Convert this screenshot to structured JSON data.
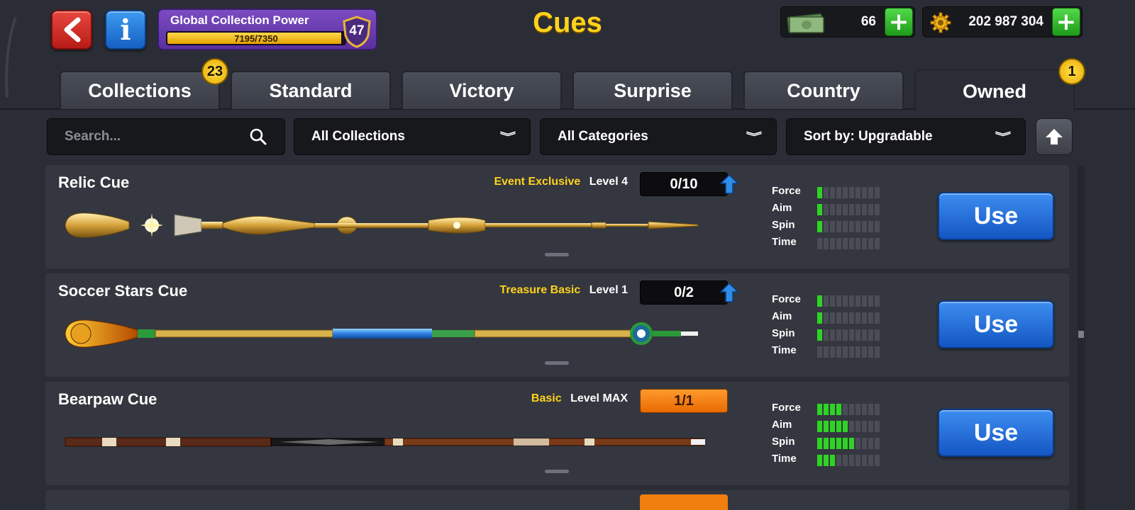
{
  "header": {
    "title": "Cues",
    "global_collection_power": {
      "label": "Global Collection Power",
      "current": 7195,
      "max": 7350,
      "progress_text": "7195/7350",
      "level": "47"
    },
    "cash": "66",
    "coins": "202 987 304",
    "plus_symbol": "+"
  },
  "tabs": [
    {
      "label": "Collections",
      "badge": "23",
      "active": false
    },
    {
      "label": "Standard",
      "active": false
    },
    {
      "label": "Victory",
      "active": false
    },
    {
      "label": "Surprise",
      "active": false
    },
    {
      "label": "Country",
      "active": false
    },
    {
      "label": "Owned",
      "badge": "1",
      "active": true
    }
  ],
  "filters": {
    "search_placeholder": "Search...",
    "collections": "All Collections",
    "categories": "All Categories",
    "sort": "Sort by: Upgradable"
  },
  "stat_labels": [
    "Force",
    "Aim",
    "Spin",
    "Time"
  ],
  "use_label": "Use",
  "cues": [
    {
      "name": "Relic Cue",
      "category": "Event Exclusive",
      "level": "Level 4",
      "progress": "0/10",
      "upgradable": true,
      "stats": {
        "force": 1,
        "aim": 1,
        "spin": 1,
        "time": 0
      }
    },
    {
      "name": "Soccer Stars Cue",
      "category": "Treasure Basic",
      "level": "Level 1",
      "progress": "0/2",
      "upgradable": true,
      "stats": {
        "force": 1,
        "aim": 1,
        "spin": 1,
        "time": 0
      }
    },
    {
      "name": "Bearpaw Cue",
      "category": "Basic",
      "level": "Level MAX",
      "progress": "1/1",
      "upgradable": false,
      "stats": {
        "force": 4,
        "aim": 5,
        "spin": 6,
        "time": 3
      }
    }
  ],
  "colors": {
    "background": "#2a2d35",
    "card": "#34373f",
    "accent_yellow": "#ffd21c",
    "stat_on": "#2fd326",
    "use_blue": "#1f6ad8",
    "max_orange": "#f07f10"
  },
  "icons": {
    "back": "chevron-left-icon",
    "info": "info-icon",
    "level": "shield-icon",
    "cash": "cash-icon",
    "coins": "gear-coin-icon",
    "search": "search-icon",
    "sort_direction": "arrow-up-icon",
    "upgrade": "upgrade-arrow-icon"
  }
}
